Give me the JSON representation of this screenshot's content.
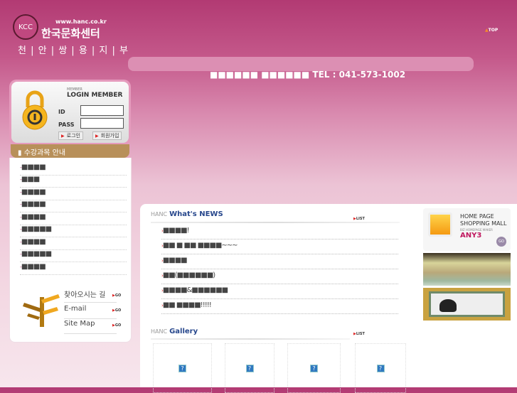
{
  "header": {
    "url": "www.hanc.co.kr",
    "name": "한국문화센터",
    "branch": "천 | 안 | 쌍 | 용 | 지 | 부",
    "seal": "KCC",
    "top_label": "TOP",
    "tel": "■■■■■■ ■■■■■■ TEL : 041-573-1002"
  },
  "login": {
    "small": "MEMBER",
    "title": "LOGIN MEMBER",
    "id_label": "ID",
    "pass_label": "PASS",
    "login_btn": "로그인",
    "join_btn": "회원가입"
  },
  "courses": {
    "title": "수강과목 안내",
    "items": [
      "■■■■",
      "■■■",
      "■■■■",
      "■■■■",
      "■■■■",
      "■■■■■",
      "■■■■",
      "■■■■■",
      "■■■■"
    ]
  },
  "quick": [
    {
      "label": "찾아오시는 길",
      "go": "GO"
    },
    {
      "label": "E-mail",
      "go": "GO"
    },
    {
      "label": "Site Map",
      "go": "GO"
    }
  ],
  "news": {
    "prefix": "HANC",
    "title": "What's NEWS",
    "list": "LIST",
    "items": [
      "■■■■!",
      "■■ ■ ■■ ■■■■~~~",
      "■■■■",
      "■■(■■■■■■)",
      "■■■■&■■■■■■",
      "■■ ■■■■!!!!!"
    ]
  },
  "gallery": {
    "prefix": "HANC",
    "title": "Gallery",
    "list": "LIST",
    "placeholder": "?"
  },
  "ads": {
    "line1": "HOME PAGE",
    "line2": "SHOPPING MALL",
    "line3": "BIZ HOMEPAGE MAKER",
    "brand": "ANY3",
    "go": "GO"
  },
  "colors": {
    "brand": "#b23a73",
    "accent": "#b8905a",
    "link": "#27478c"
  }
}
